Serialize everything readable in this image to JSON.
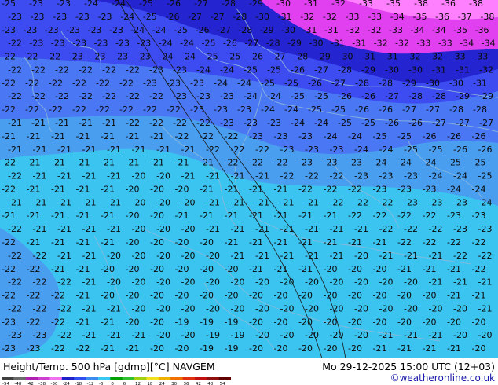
{
  "footer": {
    "title": "Height/Temp. 500 hPa [gdmp][°C] NAVGEM",
    "valid_time": "Mo 29-12-2025 15:00 UTC (12+03)",
    "credit": "©weatheronline.co.uk"
  },
  "legend": {
    "ticks": [
      "-54",
      "-48",
      "-42",
      "-38",
      "-30",
      "-24",
      "-18",
      "-12",
      "-6",
      "0",
      "6",
      "12",
      "18",
      "24",
      "30",
      "36",
      "42",
      "48",
      "54"
    ],
    "colors": [
      "#404040",
      "#6a6a6a",
      "#b020b0",
      "#d040d0",
      "#f070f0",
      "#2020c8",
      "#3050f0",
      "#3c8cf0",
      "#38c8f0",
      "#00a000",
      "#30c030",
      "#a0d010",
      "#f0e020",
      "#f0b000",
      "#f07000",
      "#e03010",
      "#c01010",
      "#901010",
      "#600000"
    ]
  },
  "map": {
    "colors": {
      "magenta_light": "#ff80ff",
      "magenta": "#e040f0",
      "blue_dark": "#2424d0",
      "blue": "#3c4cf0",
      "blue_mid": "#4a78f4",
      "blue_light": "#4a9ef0",
      "cyan": "#3cc4f0"
    },
    "labels": [
      [
        "-25",
        "-23",
        "-23",
        "-24",
        "-24",
        "-25",
        "-26",
        "-27",
        "-28",
        "-29",
        "-30",
        "-31",
        "-32",
        "-33",
        "-35",
        "-38",
        "-36",
        "-38"
      ],
      [
        "-23",
        "-23",
        "-23",
        "-23",
        "-23",
        "-24",
        "-25",
        "-26",
        "-27",
        "-27",
        "-28",
        "-30",
        "-31",
        "-32",
        "-32",
        "-33",
        "-33",
        "-34",
        "-35",
        "-36",
        "-37",
        "-38"
      ],
      [
        "-23",
        "-23",
        "-23",
        "-23",
        "-23",
        "-23",
        "-24",
        "-24",
        "-25",
        "-26",
        "-27",
        "-28",
        "-29",
        "-30",
        "-31",
        "-31",
        "-32",
        "-32",
        "-33",
        "-34",
        "-34",
        "-35",
        "-36"
      ],
      [
        "-22",
        "-23",
        "-23",
        "-23",
        "-23",
        "-23",
        "-23",
        "-24",
        "-24",
        "-25",
        "-26",
        "-27",
        "-28",
        "-29",
        "-30",
        "-31",
        "-31",
        "-32",
        "-32",
        "-33",
        "-33",
        "-34",
        "-34"
      ],
      [
        "-22",
        "-22",
        "-22",
        "-23",
        "-23",
        "-23",
        "-23",
        "-24",
        "-24",
        "-25",
        "-25",
        "-26",
        "-27",
        "-28",
        "-29",
        "-30",
        "-31",
        "-31",
        "-32",
        "-32",
        "-33",
        "-33"
      ],
      [
        "-22",
        "-22",
        "-22",
        "-22",
        "-22",
        "-22",
        "-23",
        "-23",
        "-24",
        "-24",
        "-25",
        "-25",
        "-26",
        "-27",
        "-28",
        "-29",
        "-30",
        "-30",
        "-31",
        "-31",
        "-32"
      ],
      [
        "-22",
        "-22",
        "-22",
        "-22",
        "-22",
        "-22",
        "-23",
        "-23",
        "-23",
        "-24",
        "-24",
        "-25",
        "-25",
        "-26",
        "-27",
        "-28",
        "-28",
        "-29",
        "-30",
        "-30",
        "-31"
      ],
      [
        "-22",
        "-22",
        "-22",
        "-22",
        "-22",
        "-22",
        "-22",
        "-23",
        "-23",
        "-23",
        "-24",
        "-24",
        "-25",
        "-25",
        "-26",
        "-26",
        "-27",
        "-28",
        "-28",
        "-29",
        "-29"
      ],
      [
        "-22",
        "-22",
        "-22",
        "-22",
        "-22",
        "-22",
        "-22",
        "-22",
        "-23",
        "-23",
        "-23",
        "-24",
        "-24",
        "-25",
        "-25",
        "-26",
        "-26",
        "-27",
        "-27",
        "-28",
        "-28"
      ],
      [
        "-21",
        "-21",
        "-21",
        "-21",
        "-21",
        "-22",
        "-22",
        "-22",
        "-22",
        "-23",
        "-23",
        "-23",
        "-24",
        "-24",
        "-25",
        "-25",
        "-26",
        "-26",
        "-27",
        "-27",
        "-27"
      ],
      [
        "-21",
        "-21",
        "-21",
        "-21",
        "-21",
        "-21",
        "-21",
        "-22",
        "-22",
        "-22",
        "-23",
        "-23",
        "-23",
        "-24",
        "-24",
        "-25",
        "-25",
        "-26",
        "-26",
        "-26"
      ],
      [
        "-21",
        "-21",
        "-21",
        "-21",
        "-21",
        "-21",
        "-21",
        "-21",
        "-22",
        "-22",
        "-22",
        "-23",
        "-23",
        "-23",
        "-24",
        "-24",
        "-25",
        "-25",
        "-26",
        "-26"
      ],
      [
        "-22",
        "-21",
        "-21",
        "-21",
        "-21",
        "-21",
        "-21",
        "-21",
        "-21",
        "-22",
        "-22",
        "-22",
        "-23",
        "-23",
        "-23",
        "-24",
        "-24",
        "-24",
        "-25",
        "-25"
      ],
      [
        "-22",
        "-21",
        "-21",
        "-21",
        "-21",
        "-20",
        "-20",
        "-21",
        "-21",
        "-21",
        "-21",
        "-22",
        "-22",
        "-22",
        "-23",
        "-23",
        "-23",
        "-24",
        "-24",
        "-25"
      ],
      [
        "-22",
        "-21",
        "-21",
        "-21",
        "-21",
        "-20",
        "-20",
        "-20",
        "-21",
        "-21",
        "-21",
        "-21",
        "-22",
        "-22",
        "-22",
        "-23",
        "-23",
        "-23",
        "-24",
        "-24"
      ],
      [
        "-21",
        "-21",
        "-21",
        "-21",
        "-21",
        "-20",
        "-20",
        "-20",
        "-21",
        "-21",
        "-21",
        "-21",
        "-21",
        "-22",
        "-22",
        "-22",
        "-23",
        "-23",
        "-23",
        "-24"
      ],
      [
        "-21",
        "-21",
        "-21",
        "-21",
        "-21",
        "-20",
        "-20",
        "-21",
        "-21",
        "-21",
        "-21",
        "-21",
        "-21",
        "-21",
        "-22",
        "-22",
        "-22",
        "-22",
        "-23",
        "-23"
      ],
      [
        "-22",
        "-21",
        "-21",
        "-21",
        "-21",
        "-20",
        "-20",
        "-20",
        "-21",
        "-21",
        "-21",
        "-21",
        "-21",
        "-21",
        "-21",
        "-22",
        "-22",
        "-22",
        "-23",
        "-23"
      ],
      [
        "-22",
        "-21",
        "-21",
        "-21",
        "-21",
        "-20",
        "-20",
        "-20",
        "-20",
        "-21",
        "-21",
        "-21",
        "-21",
        "-21",
        "-21",
        "-21",
        "-22",
        "-22",
        "-22",
        "-22"
      ],
      [
        "-22",
        "-22",
        "-21",
        "-21",
        "-20",
        "-20",
        "-20",
        "-20",
        "-20",
        "-21",
        "-21",
        "-21",
        "-21",
        "-21",
        "-20",
        "-21",
        "-21",
        "-21",
        "-22",
        "-22"
      ],
      [
        "-22",
        "-22",
        "-21",
        "-21",
        "-20",
        "-20",
        "-20",
        "-20",
        "-20",
        "-20",
        "-21",
        "-21",
        "-21",
        "-20",
        "-20",
        "-20",
        "-21",
        "-21",
        "-21",
        "-22"
      ],
      [
        "-22",
        "-22",
        "-22",
        "-21",
        "-20",
        "-20",
        "-20",
        "-20",
        "-20",
        "-20",
        "-20",
        "-20",
        "-20",
        "-20",
        "-20",
        "-20",
        "-20",
        "-21",
        "-21",
        "-21"
      ],
      [
        "-22",
        "-22",
        "-22",
        "-21",
        "-20",
        "-20",
        "-20",
        "-20",
        "-20",
        "-20",
        "-20",
        "-20",
        "-20",
        "-20",
        "-20",
        "-20",
        "-20",
        "-20",
        "-21",
        "-21"
      ],
      [
        "-22",
        "-22",
        "-22",
        "-21",
        "-21",
        "-20",
        "-20",
        "-20",
        "-20",
        "-20",
        "-20",
        "-20",
        "-20",
        "-20",
        "-20",
        "-20",
        "-20",
        "-20",
        "-20",
        "-21"
      ],
      [
        "-23",
        "-22",
        "-22",
        "-21",
        "-21",
        "-20",
        "-20",
        "-19",
        "-19",
        "-19",
        "-20",
        "-20",
        "-20",
        "-20",
        "-20",
        "-20",
        "-20",
        "-20",
        "-20",
        "-20"
      ],
      [
        "-23",
        "-23",
        "-22",
        "-21",
        "-21",
        "-21",
        "-20",
        "-20",
        "-19",
        "-19",
        "-20",
        "-20",
        "-20",
        "-20",
        "-20",
        "-21",
        "-21",
        "-21",
        "-20",
        "-20"
      ],
      [
        "-23",
        "-23",
        "-22",
        "-22",
        "-21",
        "-21",
        "-20",
        "-20",
        "-19",
        "-19",
        "-20",
        "-20",
        "-20",
        "-20",
        "-20",
        "-21",
        "-21",
        "-21",
        "-21",
        "-20"
      ]
    ]
  }
}
